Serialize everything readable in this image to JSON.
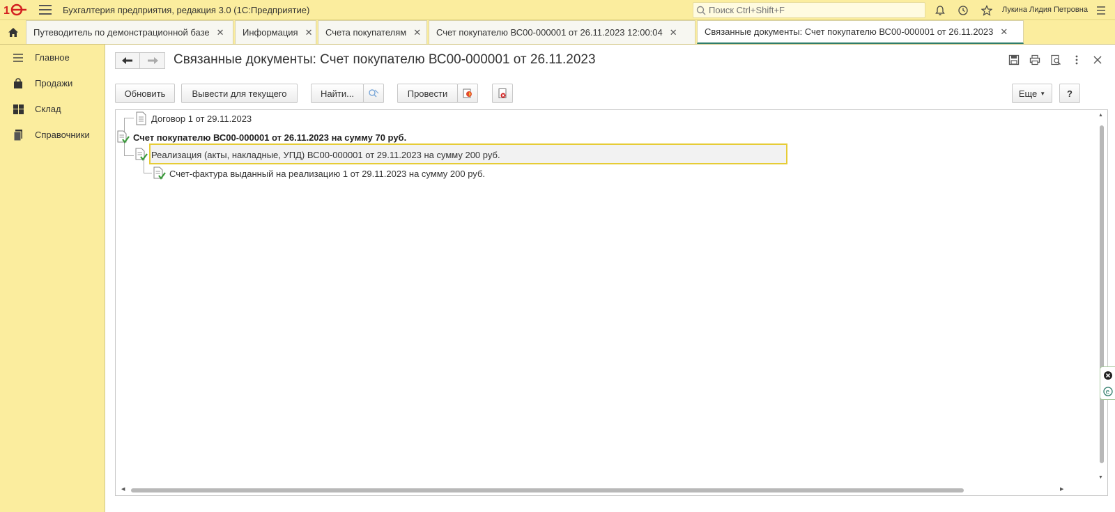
{
  "app": {
    "title": "Бухгалтерия предприятия, редакция 3.0  (1С:Предприятие)",
    "search_placeholder": "Поиск Ctrl+Shift+F",
    "user_name": "Лукина Лидия Петровна"
  },
  "tabs": [
    {
      "label": "Путеводитель по демонстрационной базе"
    },
    {
      "label": "Информация"
    },
    {
      "label": "Счета покупателям"
    },
    {
      "label": "Счет покупателю ВС00-000001 от 26.11.2023 12:00:04"
    },
    {
      "label": "Связанные документы: Счет покупателю ВС00-000001 от 26.11.2023"
    }
  ],
  "sidebar": {
    "items": [
      {
        "label": "Главное",
        "icon": "menu-lines-icon"
      },
      {
        "label": "Продажи",
        "icon": "shopping-bag-icon"
      },
      {
        "label": "Склад",
        "icon": "warehouse-grid-icon"
      },
      {
        "label": "Справочники",
        "icon": "books-icon"
      }
    ]
  },
  "main": {
    "title": "Связанные документы: Счет покупателю ВС00-000001 от 26.11.2023",
    "toolbar": {
      "refresh": "Обновить",
      "show_for_current": "Вывести для текущего",
      "find": "Найти...",
      "post": "Провести",
      "more": "Еще",
      "help": "?"
    },
    "tree": [
      {
        "label": "Договор 1 от 29.11.2023",
        "bold": false
      },
      {
        "label": "Счет покупателю ВС00-000001 от 26.11.2023 на сумму 70 руб.",
        "bold": true
      },
      {
        "label": "Реализация (акты, накладные, УПД) ВС00-000001 от 29.11.2023 на сумму 200 руб.",
        "bold": false
      },
      {
        "label": "Счет-фактура выданный на реализацию 1 от 29.11.2023 на сумму 200 руб.",
        "bold": false
      }
    ]
  },
  "colors": {
    "brand_yellow": "#fbed9e",
    "active_tab_accent": "#2f7d6b",
    "selection_border": "#e6cc36",
    "posted_check": "#3a9a3a"
  }
}
